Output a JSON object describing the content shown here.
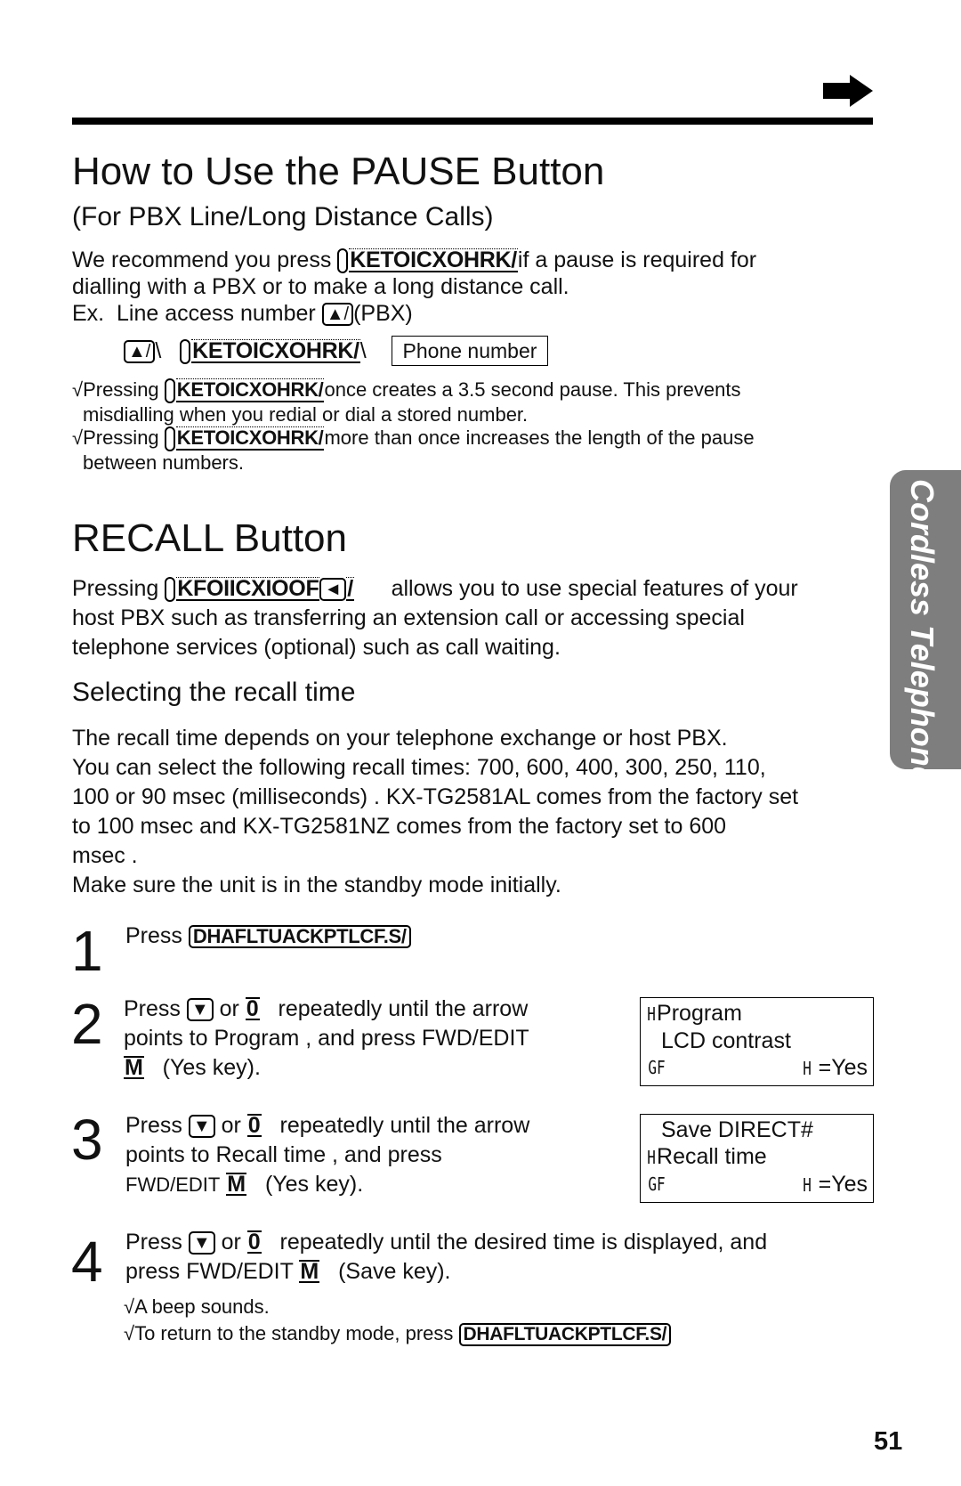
{
  "header": {
    "next_icon": "arrow-right-icon"
  },
  "pause_section": {
    "title": "How to Use the PAUSE Button",
    "subtitle": "(For PBX Line/Long Distance Calls)",
    "intro_pre": "We recommend you press",
    "pause_key": "KETOICXOHRK/",
    "intro_post": "if a pause is required for",
    "intro_line2": "dialling with a PBX or to make a long distance call.",
    "example_label": "Ex.",
    "example_text": "Line access number",
    "line_access_key": "▲/",
    "example_post": "(PBX)",
    "sequence_sep": "\\",
    "phone_number_box": "Phone number",
    "bullets": [
      {
        "pre": "√Pressing",
        "post": "once creates a 3.5 second pause. This prevents",
        "cont": "misdialling when you redial or dial a stored number."
      },
      {
        "pre": "√Pressing",
        "post": "more than once increases the length of the pause",
        "cont": "between numbers."
      }
    ]
  },
  "recall_section": {
    "title": "RECALL Button",
    "body_pre": "Pressing",
    "recall_key": "KFOIICXIOOF",
    "recall_icon_glyph": "◄",
    "recall_key_tail": "/",
    "body_post": "allows you to use special features of your",
    "body_line2": "host PBX such as transferring an extension call or accessing special",
    "body_line3": "telephone services (optional) such as call waiting."
  },
  "recall_time_section": {
    "title": "Selecting the recall time",
    "lines": [
      "The recall time depends on your telephone exchange or host PBX.",
      "You can select the following recall times:  700, 600, 400, 300, 250, 110,",
      "100 or 90 msec (milliseconds) . KX-TG2581AL comes from the factory set",
      "to  100 msec  and KX-TG2581NZ comes from the factory set to  600",
      "msec .",
      "Make sure the unit is in the standby mode initially."
    ]
  },
  "steps": [
    {
      "num": "1",
      "pre": "Press",
      "key": "DHAFLTUACKPTLCF.S/"
    },
    {
      "num": "2",
      "line1_pre": "Press",
      "down_glyph": "▼",
      "or": "or",
      "zero_key": "0",
      "line1_post": "repeatedly until the arrow",
      "line2": "points to  Program   , and press FWD/EDIT",
      "m_key": "M",
      "line3_post": "(Yes key)."
    },
    {
      "num": "3",
      "line1_pre": "Press",
      "down_glyph": "▼",
      "or": "or",
      "zero_key": "0",
      "line1_post": "repeatedly until the arrow",
      "line2": "points to  Recall time       , and press",
      "line3_pre": "FWD/EDIT",
      "m_key": "M",
      "line3_post": "(Yes key)."
    },
    {
      "num": "4",
      "line1_pre": "Press",
      "down_glyph": "▼",
      "or": "or",
      "zero_key": "0",
      "line1_post": "repeatedly until the desired time is displayed, and",
      "line2_pre": "press FWD/EDIT",
      "m_key": "M",
      "line2_post": "(Save  key).",
      "notes": [
        "√A beep sounds.",
        "√To return to the standby mode, press"
      ],
      "note_key": "DHAFLTUACKPTLCF.S/"
    }
  ],
  "lcd_displays": [
    {
      "row1_mark": "H",
      "row1": "Program",
      "row2_mark": "",
      "row2": "LCD contrast",
      "row3_left": "GF",
      "row3_mark": "H",
      "row3_right": "=Yes"
    },
    {
      "row1_mark": "",
      "row1": "Save DIRECT#",
      "row2_mark": "H",
      "row2": "Recall time",
      "row3_left": "GF",
      "row3_mark": "H",
      "row3_right": "=Yes"
    }
  ],
  "side_tab": {
    "label": "Cordless Telephone",
    "color": "#7e7e7e"
  },
  "page_number": "51"
}
